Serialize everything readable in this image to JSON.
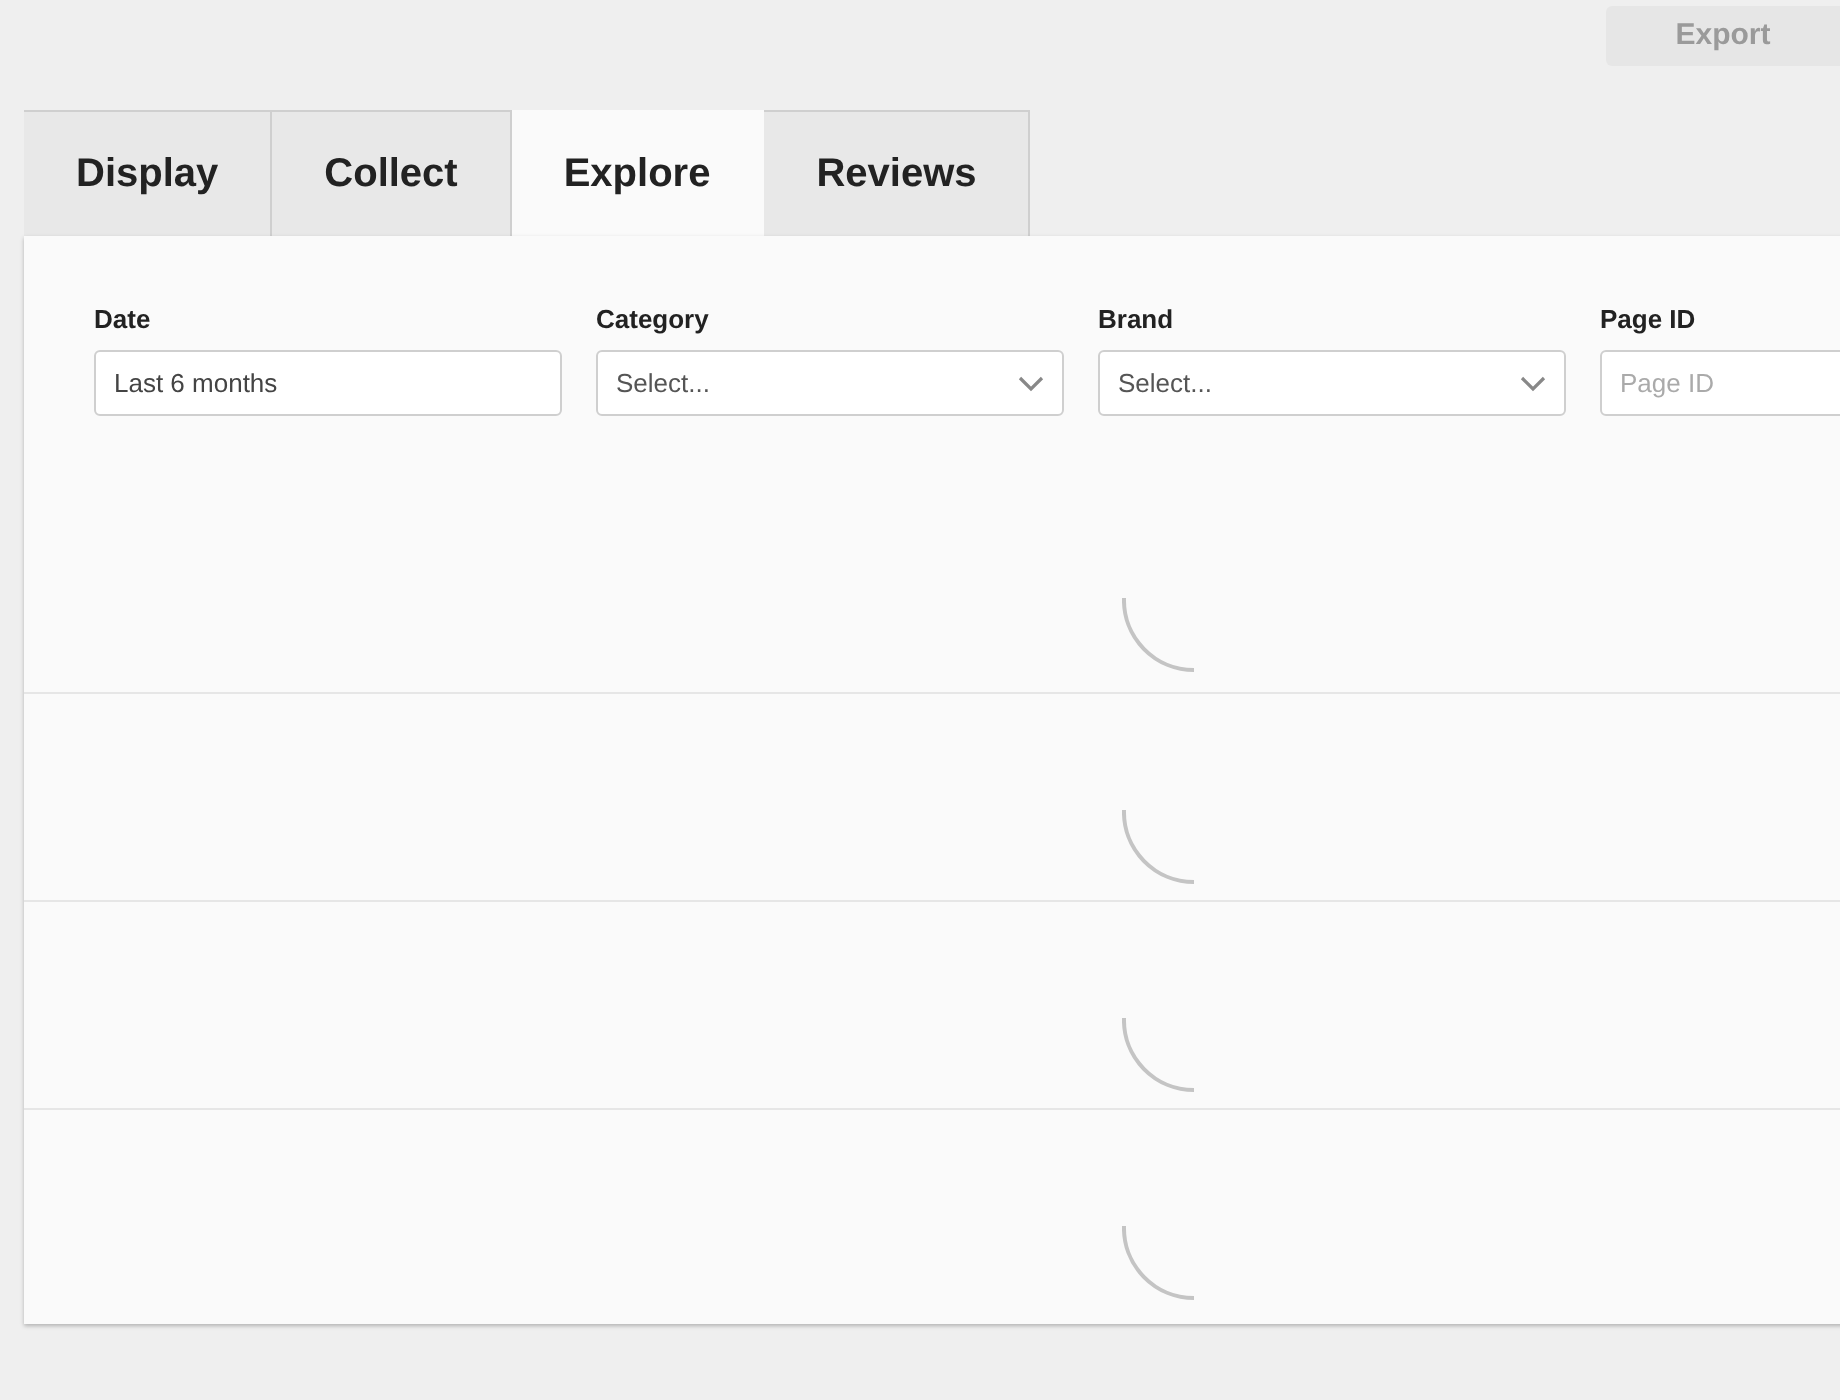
{
  "export_button": {
    "label": "Export",
    "disabled": true
  },
  "tabs": [
    {
      "label": "Display",
      "selected": false
    },
    {
      "label": "Collect",
      "selected": false
    },
    {
      "label": "Explore",
      "selected": true
    },
    {
      "label": "Reviews",
      "selected": false
    }
  ],
  "filters": [
    {
      "label": "Date",
      "kind": "text",
      "value": "Last 6 months"
    },
    {
      "label": "Category",
      "kind": "select",
      "placeholder": "Select..."
    },
    {
      "label": "Brand",
      "kind": "select",
      "placeholder": "Select..."
    },
    {
      "label": "Page ID",
      "kind": "text",
      "placeholder": "Page ID"
    }
  ],
  "panels": [
    {
      "kind": "loading"
    },
    {
      "kind": "loading"
    },
    {
      "kind": "loading"
    },
    {
      "kind": "loading"
    }
  ]
}
